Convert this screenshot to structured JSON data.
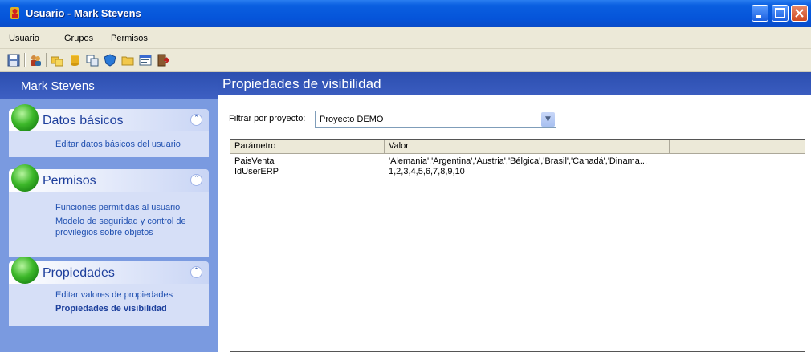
{
  "window": {
    "title": "Usuario - Mark Stevens"
  },
  "menu": [
    "Usuario",
    "Grupos",
    "Permisos"
  ],
  "toolbar": {
    "icons": [
      "save-icon",
      "users-icon",
      "group-icon",
      "database-icon",
      "copy-icon",
      "shield-icon",
      "folder-icon",
      "properties-icon",
      "exit-icon"
    ]
  },
  "sidebar": {
    "header": "Mark Stevens",
    "groups": [
      {
        "title": "Datos básicos",
        "links": [
          "Editar datos básicos del usuario"
        ]
      },
      {
        "title": "Permisos",
        "links": [
          "Funciones permitidas al usuario",
          "Modelo de seguridad y control de",
          "provilegios sobre objetos"
        ]
      },
      {
        "title": "Propiedades",
        "links": [
          "Editar valores de propiedades",
          "Propiedades de visibilidad"
        ]
      }
    ]
  },
  "main": {
    "header": "Propiedades de visibilidad",
    "filter_label": "Filtrar por proyecto:",
    "filter_value": "Proyecto DEMO",
    "columns": [
      "Parámetro",
      "Valor",
      ""
    ],
    "rows": [
      {
        "param": "PaisVenta",
        "value": "'Alemania','Argentina','Austria','Bélgica','Brasil','Canadá','Dinama..."
      },
      {
        "param": "IdUserERP",
        "value": "1,2,3,4,5,6,7,8,9,10"
      }
    ]
  }
}
